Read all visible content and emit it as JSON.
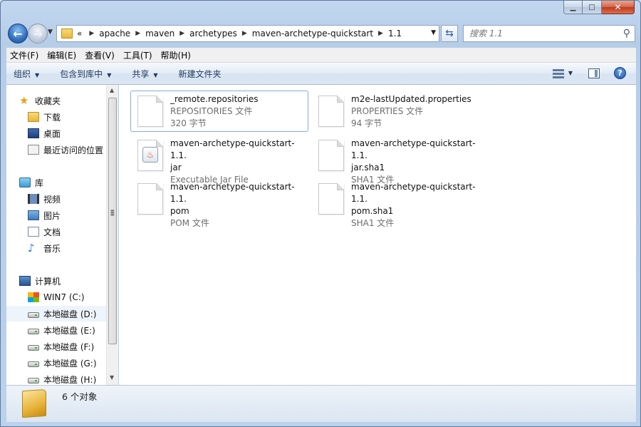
{
  "window": {
    "caption": {
      "minimize": "▁",
      "maximize": "□",
      "close": "✕"
    }
  },
  "nav": {
    "back_icon": "back-arrow-icon",
    "forward_icon": "forward-arrow-icon",
    "breadcrumb_prefix": "«",
    "breadcrumbs": [
      "apache",
      "maven",
      "archetypes",
      "maven-archetype-quickstart",
      "1.1"
    ],
    "search_placeholder": "搜索 1.1"
  },
  "menubar": {
    "items": [
      "文件(F)",
      "编辑(E)",
      "查看(V)",
      "工具(T)",
      "帮助(H)"
    ]
  },
  "commandbar": {
    "organize": "组织",
    "include_in_library": "包含到库中",
    "share": "共享",
    "new_folder": "新建文件夹"
  },
  "sidebar": {
    "favorites": {
      "label": "收藏夹",
      "items": [
        "下载",
        "桌面",
        "最近访问的位置"
      ]
    },
    "libraries": {
      "label": "库",
      "items": [
        "视频",
        "图片",
        "文档",
        "音乐"
      ]
    },
    "computer": {
      "label": "计算机",
      "items": [
        "WIN7 (C:)",
        "本地磁盘 (D:)",
        "本地磁盘 (E:)",
        "本地磁盘 (F:)",
        "本地磁盘 (G:)",
        "本地磁盘 (H:)"
      ],
      "selected": "本地磁盘 (D:)"
    }
  },
  "files": [
    {
      "name": "_remote.repositories",
      "name2": "",
      "type": "REPOSITORIES 文件",
      "size": "320 字节",
      "icon": "generic-file-icon",
      "selected": true
    },
    {
      "name": "m2e-lastUpdated.properties",
      "name2": "",
      "type": "PROPERTIES 文件",
      "size": "94 字节",
      "icon": "generic-file-icon",
      "selected": false
    },
    {
      "name": "maven-archetype-quickstart-1.1.",
      "name2": "jar",
      "type": "Executable Jar File",
      "size": "",
      "icon": "java-jar-icon",
      "selected": false
    },
    {
      "name": "maven-archetype-quickstart-1.1.",
      "name2": "jar.sha1",
      "type": "SHA1 文件",
      "size": "",
      "icon": "generic-file-icon",
      "selected": false
    },
    {
      "name": "maven-archetype-quickstart-1.1.",
      "name2": "pom",
      "type": "POM 文件",
      "size": "",
      "icon": "generic-file-icon",
      "selected": false
    },
    {
      "name": "maven-archetype-quickstart-1.1.",
      "name2": "pom.sha1",
      "type": "SHA1 文件",
      "size": "",
      "icon": "generic-file-icon",
      "selected": false
    }
  ],
  "status": {
    "count_text": "6 个对象"
  },
  "colors": {
    "selection_border": "#84acdd",
    "command_text": "#1e395b"
  }
}
